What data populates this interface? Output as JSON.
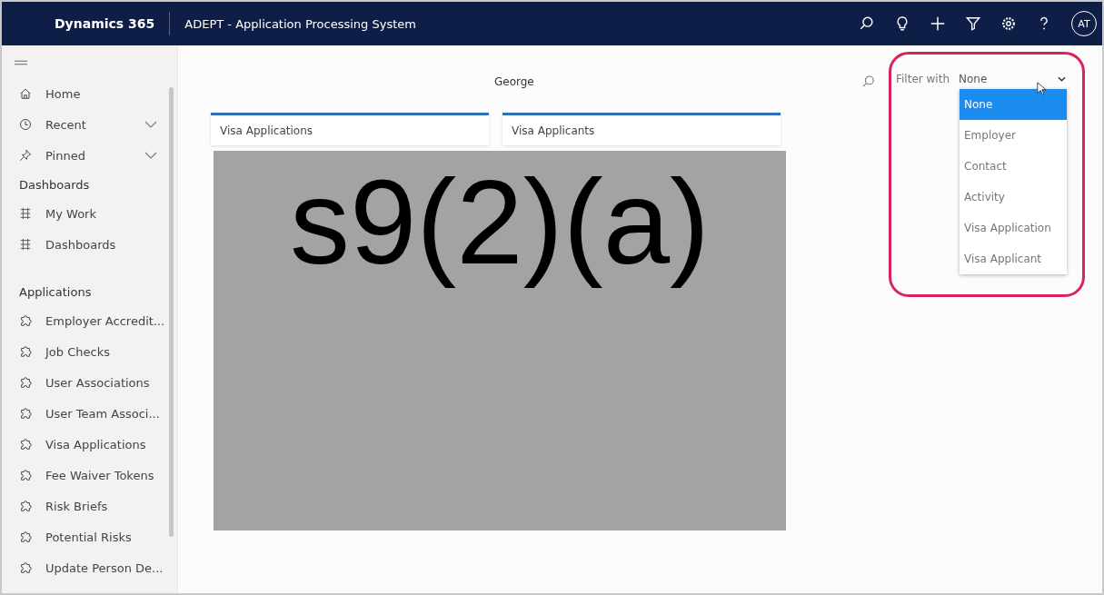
{
  "top_bar": {
    "product": "Dynamics 365",
    "app_title": "ADEPT - Application Processing System",
    "avatar": "AT"
  },
  "sidebar": {
    "nav": [
      {
        "kind": "home",
        "label": "Home",
        "expandable": false
      },
      {
        "kind": "recent",
        "label": "Recent",
        "expandable": true
      },
      {
        "kind": "pinned",
        "label": "Pinned",
        "expandable": true
      }
    ],
    "groups": [
      {
        "title": "Dashboards",
        "items": [
          {
            "kind": "dashboard",
            "label": "My Work"
          },
          {
            "kind": "dashboard",
            "label": "Dashboards"
          }
        ]
      },
      {
        "title": "Applications",
        "items": [
          {
            "kind": "entity",
            "label": "Employer Accredit..."
          },
          {
            "kind": "entity",
            "label": "Job Checks"
          },
          {
            "kind": "entity",
            "label": "User Associations"
          },
          {
            "kind": "entity",
            "label": "User Team Associ..."
          },
          {
            "kind": "entity",
            "label": "Visa Applications"
          },
          {
            "kind": "entity",
            "label": "Fee Waiver Tokens"
          },
          {
            "kind": "entity",
            "label": "Risk Briefs"
          },
          {
            "kind": "entity",
            "label": "Potential Risks"
          },
          {
            "kind": "entity",
            "label": "Update Person De..."
          }
        ]
      }
    ]
  },
  "search": {
    "value": "George"
  },
  "filter": {
    "label": "Filter with",
    "value": "None",
    "options": [
      {
        "label": "None",
        "selected": true
      },
      {
        "label": "Employer",
        "selected": false
      },
      {
        "label": "Contact",
        "selected": false
      },
      {
        "label": "Activity",
        "selected": false
      },
      {
        "label": "Visa Application",
        "selected": false
      },
      {
        "label": "Visa Applicant",
        "selected": false
      }
    ]
  },
  "result_tabs": [
    {
      "label": "Visa Applications"
    },
    {
      "label": "Visa Applicants"
    }
  ],
  "redaction": {
    "label": "s9(2)(a)"
  }
}
